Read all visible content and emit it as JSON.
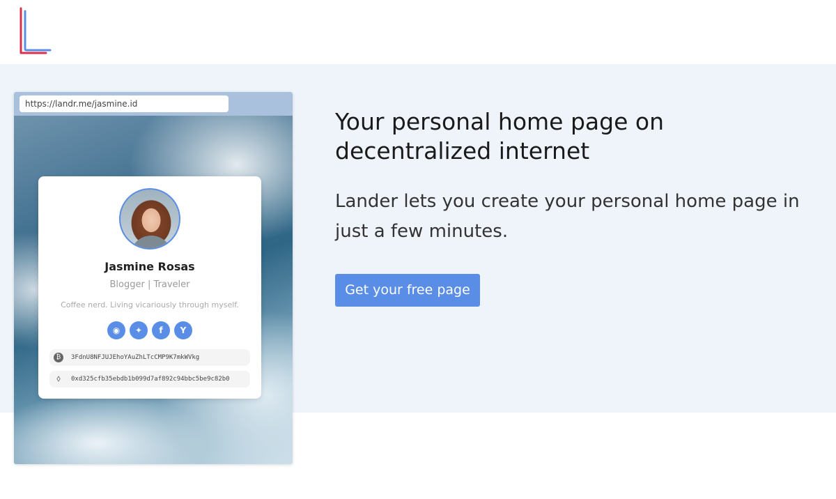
{
  "brand": {
    "logo_icon": "lander-logo-icon",
    "colors": {
      "blue": "#5a8ee6",
      "red": "#d8324a"
    }
  },
  "preview": {
    "url": "https://landr.me/jasmine.id",
    "profile": {
      "name": "Jasmine Rosas",
      "role": "Blogger | Traveler",
      "bio": "Coffee nerd. Living vicariously through myself.",
      "socials": [
        {
          "icon": "github-icon",
          "glyph": "◉"
        },
        {
          "icon": "twitter-icon",
          "glyph": "✦"
        },
        {
          "icon": "facebook-icon",
          "glyph": "f"
        },
        {
          "icon": "ycombinator-icon",
          "glyph": "Y"
        }
      ],
      "wallets": [
        {
          "icon": "bitcoin-icon",
          "glyph": "₿",
          "address": "3FdnU8NFJUJEhoYAuZhLTcCMP9K7mkWVkg"
        },
        {
          "icon": "ethereum-icon",
          "glyph": "⬨",
          "address": "0xd325cfb35ebdb1b099d7af892c94bbc5be9c82b0"
        }
      ]
    }
  },
  "hero": {
    "headline": "Your personal home page on decentralized internet",
    "subline": "Lander lets you create your personal home page in just a few minutes.",
    "cta_label": "Get your free page"
  }
}
